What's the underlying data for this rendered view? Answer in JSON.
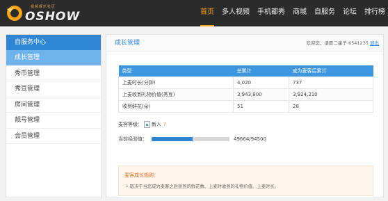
{
  "brand": {
    "subtitle": "视频娱乐社区",
    "name": "OSHOW"
  },
  "nav": [
    {
      "label": "首页",
      "active": true
    },
    {
      "label": "多人视频",
      "active": false
    },
    {
      "label": "手机都秀",
      "active": false
    },
    {
      "label": "商城",
      "active": false
    },
    {
      "label": "自服务",
      "active": false
    },
    {
      "label": "论坛",
      "active": false
    },
    {
      "label": "排行榜",
      "active": false
    }
  ],
  "sidebar": {
    "title": "自服务中心",
    "items": [
      {
        "label": "成长管理",
        "active": true
      },
      {
        "label": "秀币管理",
        "active": false
      },
      {
        "label": "秀豆管理",
        "active": false
      },
      {
        "label": "房间管理",
        "active": false
      },
      {
        "label": "靓号管理",
        "active": false
      },
      {
        "label": "会员管理",
        "active": false
      }
    ]
  },
  "main": {
    "title": "成长管理",
    "welcome": "欢迎您，请愿二蛋子 6541235",
    "logout": "退出"
  },
  "table": {
    "headers": [
      "类型",
      "总累计",
      "成为麦客后累计"
    ],
    "rows": [
      [
        "上麦时长(分钟)",
        "4,020",
        "737"
      ],
      [
        "上麦收到礼物价值(秀豆)",
        "3,943,800",
        "3,924,210"
      ],
      [
        "收到鲜花(朵)",
        "51",
        "28"
      ]
    ]
  },
  "level": {
    "label": "麦客等级：",
    "value": "新人",
    "help": "?"
  },
  "experience": {
    "label": "当前经验值：",
    "current": 49664,
    "max": 94500,
    "text": "49664/94500"
  },
  "rules": {
    "title": "麦客成长规则：",
    "text": "• 取决于当您成为麦客之后受到的鲜花数、上麦时收到的礼物价值、上麦时长。"
  },
  "colors": {
    "accent": "#2f86d4",
    "nav_active": "#f7a21b",
    "rule_title": "#e36b1e"
  }
}
